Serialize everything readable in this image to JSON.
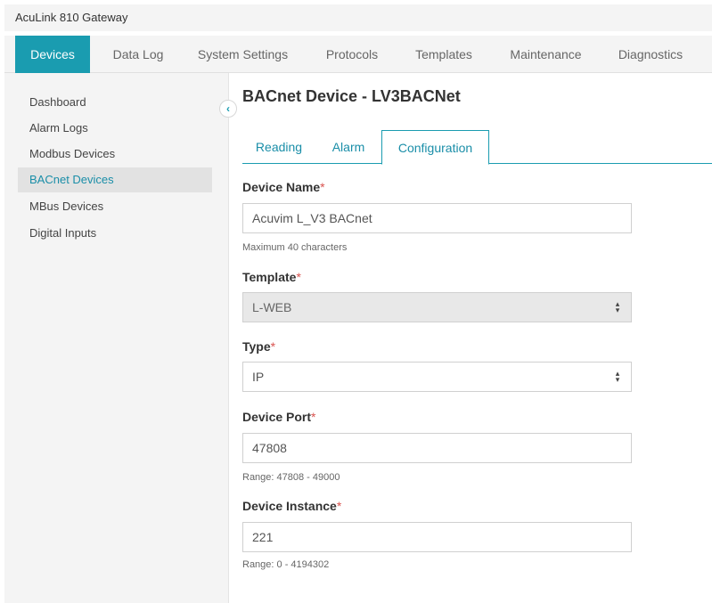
{
  "app": {
    "title": "AcuLink 810 Gateway"
  },
  "topnav": {
    "tabs": [
      {
        "label": "Devices"
      },
      {
        "label": "Data Log"
      },
      {
        "label": "System Settings"
      },
      {
        "label": "Protocols"
      },
      {
        "label": "Templates"
      },
      {
        "label": "Maintenance"
      },
      {
        "label": "Diagnostics"
      }
    ],
    "active": "Devices"
  },
  "sidebar": {
    "items": [
      {
        "label": "Dashboard"
      },
      {
        "label": "Alarm Logs"
      },
      {
        "label": "Modbus Devices"
      },
      {
        "label": "BACnet Devices"
      },
      {
        "label": "MBus Devices"
      },
      {
        "label": "Digital Inputs"
      }
    ],
    "active": "BACnet Devices",
    "collapse_icon": "chevron-left-icon"
  },
  "page": {
    "title": "BACnet Device - LV3BACNet"
  },
  "subtabs": {
    "tabs": [
      {
        "label": "Reading"
      },
      {
        "label": "Alarm"
      },
      {
        "label": "Configuration"
      }
    ],
    "active": "Configuration"
  },
  "form": {
    "required_mark": "*",
    "device_name": {
      "label": "Device Name",
      "value": "Acuvim L_V3 BACnet",
      "hint": "Maximum 40 characters"
    },
    "template": {
      "label": "Template",
      "value": "L-WEB",
      "disabled": true
    },
    "type": {
      "label": "Type",
      "value": "IP"
    },
    "device_port": {
      "label": "Device Port",
      "value": "47808",
      "hint": "Range: 47808 - 49000"
    },
    "device_instance": {
      "label": "Device Instance",
      "value": "221",
      "hint": "Range: 0 - 4194302"
    }
  },
  "colors": {
    "accent": "#1a9cb0",
    "required": "#d9534f",
    "sidebar_bg": "#f4f4f4"
  }
}
